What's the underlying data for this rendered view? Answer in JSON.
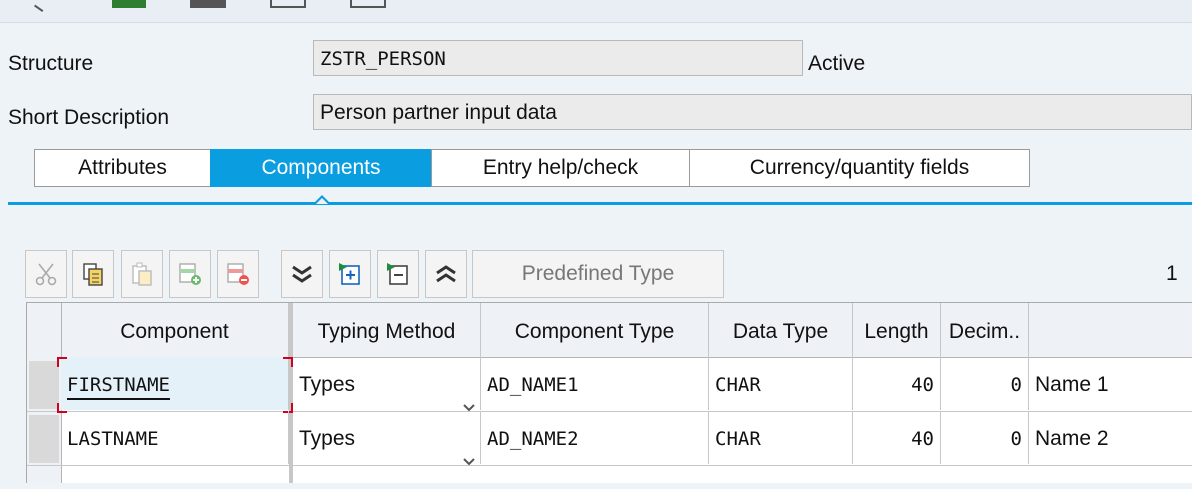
{
  "header": {
    "structure_label": "Structure",
    "structure_value": "ZSTR_PERSON",
    "status": "Active",
    "short_desc_label": "Short Description",
    "short_desc_value": "Person partner input data"
  },
  "tabs": [
    {
      "label": "Attributes",
      "active": false
    },
    {
      "label": "Components",
      "active": true
    },
    {
      "label": "Entry help/check",
      "active": false
    },
    {
      "label": "Currency/quantity fields",
      "active": false
    }
  ],
  "toolbar": {
    "buttons": [
      "cut-icon",
      "copy-icon",
      "paste-icon",
      "insert-row-icon",
      "delete-row-icon",
      "expand-down-icon",
      "insert-icon",
      "delete-icon",
      "collapse-up-icon"
    ],
    "predefined_type_label": "Predefined Type",
    "page": "1"
  },
  "table": {
    "columns": [
      "Component",
      "Typing Method",
      "Component Type",
      "Data Type",
      "Length",
      "Decim..",
      ""
    ],
    "rows": [
      {
        "component": "FIRSTNAME",
        "typing": "Types",
        "comp_type": "AD_NAME1",
        "data_type": "CHAR",
        "length": "40",
        "decimals": "0",
        "description": "Name 1"
      },
      {
        "component": "LASTNAME",
        "typing": "Types",
        "comp_type": "AD_NAME2",
        "data_type": "CHAR",
        "length": "40",
        "decimals": "0",
        "description": "Name 2"
      }
    ]
  },
  "colors": {
    "accent": "#0a9ee0",
    "focus": "#d0021b"
  }
}
